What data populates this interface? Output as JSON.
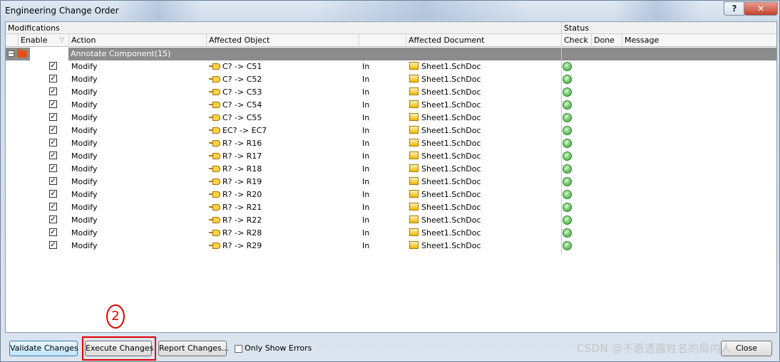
{
  "window": {
    "title": "Engineering Change Order",
    "help_label": "?",
    "close_label": "✕"
  },
  "groups": {
    "modifications": "Modifications",
    "status": "Status"
  },
  "columns": {
    "enable": "Enable",
    "action": "Action",
    "affected_object": "Affected Object",
    "affected_document": "Affected Document",
    "check": "Check",
    "done": "Done",
    "message": "Message"
  },
  "group_row": {
    "label": "Annotate Component(15)",
    "expander": "−"
  },
  "rows": [
    {
      "enabled": true,
      "action": "Modify",
      "object": "C? -> C51",
      "direction": "In",
      "document": "Sheet1.SchDoc",
      "check": "ok"
    },
    {
      "enabled": true,
      "action": "Modify",
      "object": "C? -> C52",
      "direction": "In",
      "document": "Sheet1.SchDoc",
      "check": "ok"
    },
    {
      "enabled": true,
      "action": "Modify",
      "object": "C? -> C53",
      "direction": "In",
      "document": "Sheet1.SchDoc",
      "check": "ok"
    },
    {
      "enabled": true,
      "action": "Modify",
      "object": "C? -> C54",
      "direction": "In",
      "document": "Sheet1.SchDoc",
      "check": "ok"
    },
    {
      "enabled": true,
      "action": "Modify",
      "object": "C? -> C55",
      "direction": "In",
      "document": "Sheet1.SchDoc",
      "check": "ok"
    },
    {
      "enabled": true,
      "action": "Modify",
      "object": "EC? -> EC7",
      "direction": "In",
      "document": "Sheet1.SchDoc",
      "check": "ok"
    },
    {
      "enabled": true,
      "action": "Modify",
      "object": "R? -> R16",
      "direction": "In",
      "document": "Sheet1.SchDoc",
      "check": "ok"
    },
    {
      "enabled": true,
      "action": "Modify",
      "object": "R? -> R17",
      "direction": "In",
      "document": "Sheet1.SchDoc",
      "check": "ok"
    },
    {
      "enabled": true,
      "action": "Modify",
      "object": "R? -> R18",
      "direction": "In",
      "document": "Sheet1.SchDoc",
      "check": "ok"
    },
    {
      "enabled": true,
      "action": "Modify",
      "object": "R? -> R19",
      "direction": "In",
      "document": "Sheet1.SchDoc",
      "check": "ok"
    },
    {
      "enabled": true,
      "action": "Modify",
      "object": "R? -> R20",
      "direction": "In",
      "document": "Sheet1.SchDoc",
      "check": "ok"
    },
    {
      "enabled": true,
      "action": "Modify",
      "object": "R? -> R21",
      "direction": "In",
      "document": "Sheet1.SchDoc",
      "check": "ok"
    },
    {
      "enabled": true,
      "action": "Modify",
      "object": "R? -> R22",
      "direction": "In",
      "document": "Sheet1.SchDoc",
      "check": "ok"
    },
    {
      "enabled": true,
      "action": "Modify",
      "object": "R? -> R28",
      "direction": "In",
      "document": "Sheet1.SchDoc",
      "check": "ok"
    },
    {
      "enabled": true,
      "action": "Modify",
      "object": "R? -> R29",
      "direction": "In",
      "document": "Sheet1.SchDoc",
      "check": "ok"
    }
  ],
  "footer": {
    "validate": "Validate Changes",
    "execute": "Execute Changes",
    "report": "Report Changes...",
    "only_errors": "Only Show Errors",
    "close": "Close",
    "annotation_number": "2"
  },
  "watermark": "CSDN @不愿透露姓名的局内人",
  "colors": {
    "group_row_bg": "#8c8c8c",
    "annotation_red": "#e00000",
    "check_green": "#3aa83a"
  }
}
